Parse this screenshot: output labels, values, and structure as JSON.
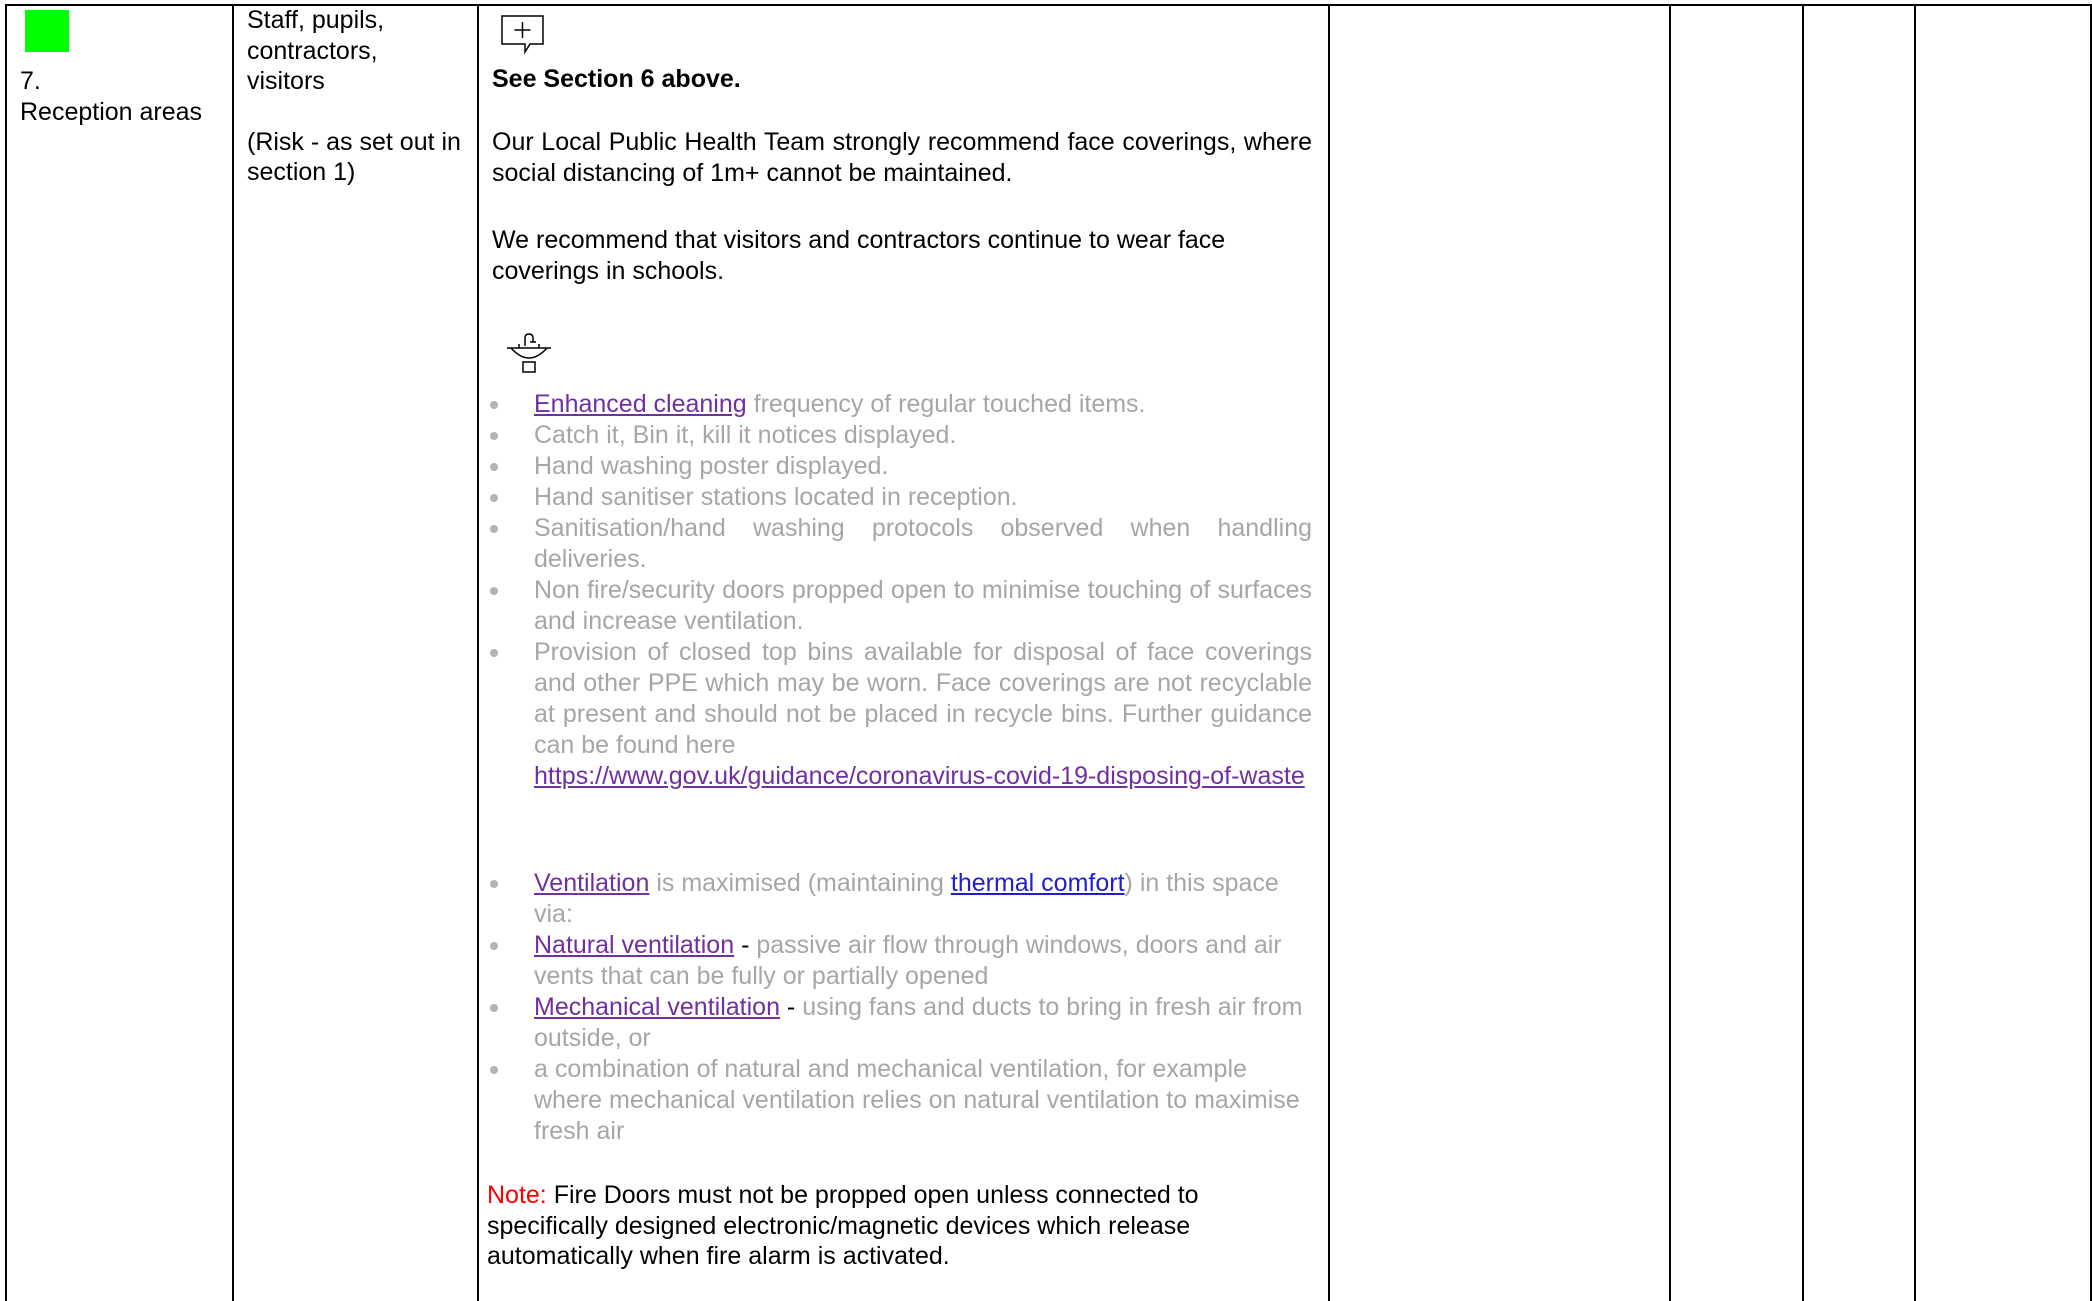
{
  "row": {
    "number": "7.",
    "area": "Reception areas",
    "risk_rating_color": "#00ff00",
    "who_at_risk": "Staff, pupils, contractors, visitors",
    "risk_note": "(Risk - as set out in section 1)"
  },
  "controls": {
    "comment_icon": "comment-add-icon",
    "see_section": "See Section 6 above.",
    "face_coverings_para": "Our Local Public Health Team strongly recommend face coverings, where social distancing of 1m+ cannot be maintained.",
    "visitors_para": "We recommend that visitors and contractors continue to wear face coverings in schools.",
    "sink_icon": "hand-wash-sink-icon",
    "bullets_hygiene": [
      {
        "link": "Enhanced cleaning",
        "text": " frequency of regular touched items."
      },
      {
        "text": "Catch it, Bin it, kill it notices displayed."
      },
      {
        "text": "Hand washing poster displayed."
      },
      {
        "text": "Hand sanitiser stations located in reception."
      },
      {
        "text": "Sanitisation/hand washing protocols observed when handling deliveries."
      },
      {
        "text": "Non fire/security doors propped open to minimise touching of surfaces and increase ventilation."
      },
      {
        "text": "Provision of closed top bins available for disposal of face coverings and other PPE which may be worn. Face coverings are not recyclable at present and should not be placed in recycle bins. Further guidance can be found here",
        "link_after": "https://www.gov.uk/guidance/coronavirus-covid-19-disposing-of-waste"
      }
    ],
    "ventilation": {
      "link1": "Ventilation",
      "text1": " is maximised (maintaining ",
      "link2": "thermal comfort",
      "text2": ") in this space via:",
      "natural_link": "Natural ventilation",
      "natural_dash": " - ",
      "natural_text": "passive air flow through windows, doors and air vents that can be fully or partially opened",
      "mechanical_link": "Mechanical ventilation",
      "mechanical_dash": " - ",
      "mechanical_text": "using fans and ducts to bring in fresh air from outside, or",
      "combination_text": "a combination of natural and mechanical ventilation, for example where mechanical ventilation relies on natural ventilation to maximise fresh air"
    },
    "note_label": "Note:",
    "note_text": " Fire Doors must not be propped open unless connected to specifically designed electronic/magnetic devices which release automatically when fire alarm is activated."
  },
  "colors": {
    "link": "#7030a0",
    "muted_text": "#a6a6a6",
    "note_label": "#ff0000",
    "risk_green": "#00ff00"
  }
}
